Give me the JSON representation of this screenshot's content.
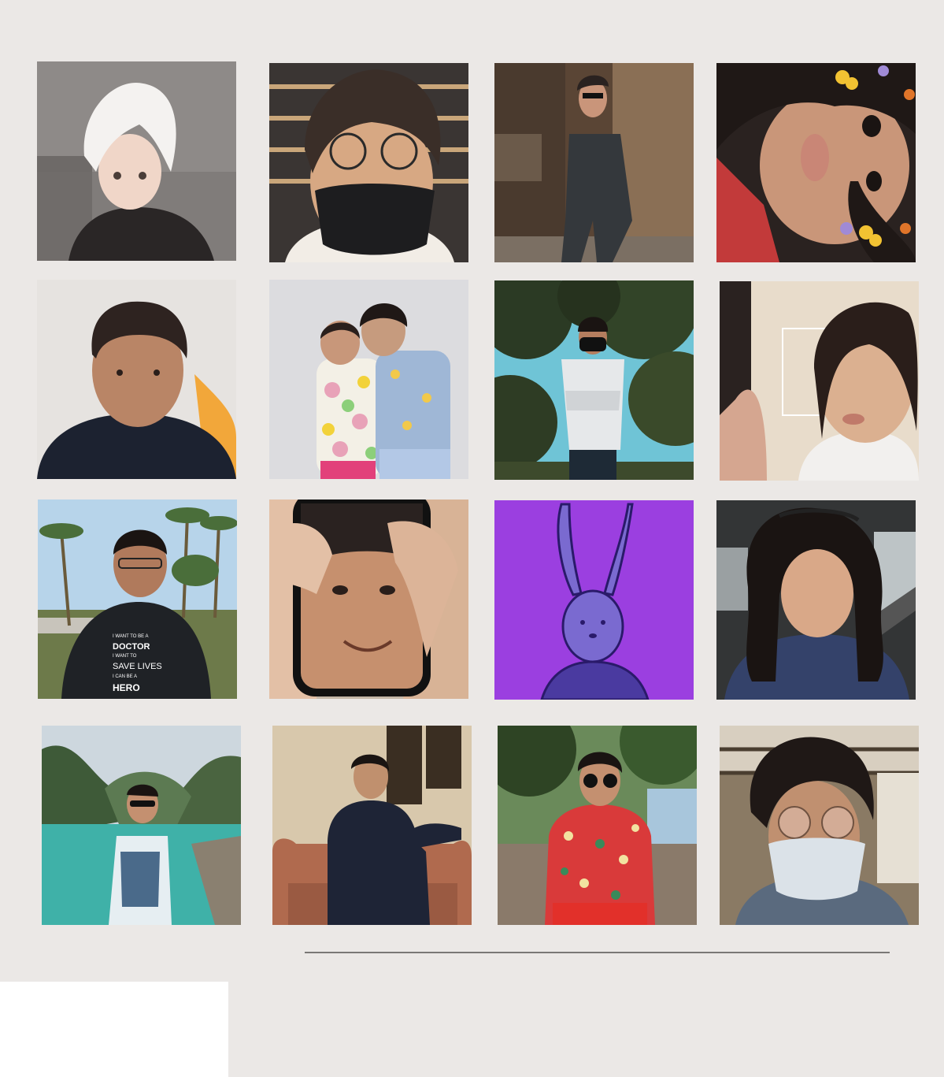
{
  "photos": [
    {
      "subject": "anime-style illustrated portrait, white hair",
      "shirt_text": ""
    },
    {
      "subject": "selfie with glasses and black face mask",
      "shirt_text": ""
    },
    {
      "subject": "mirror selfie in suit sitting on chair",
      "shirt_text": ""
    },
    {
      "subject": "selfie with butterfly stickers",
      "shirt_text": ""
    },
    {
      "subject": "portrait in dark t-shirt",
      "shirt_text": ""
    },
    {
      "subject": "two children posing in patterned tops",
      "shirt_text": ""
    },
    {
      "subject": "person in mask under tree, arms crossed",
      "shirt_text": ""
    },
    {
      "subject": "close-up selfie",
      "shirt_text": ""
    },
    {
      "subject": "portrait with palm trees",
      "shirt_text": "I WANT TO BE A DOCTOR I WANT TO SAVE LIVES I CAN BE A HERO"
    },
    {
      "subject": "phone showing a face held in hand",
      "shirt_text": ""
    },
    {
      "subject": "purple background rabbit drawing",
      "shirt_text": ""
    },
    {
      "subject": "car selfie",
      "shirt_text": ""
    },
    {
      "subject": "person by lagoon with cliffs",
      "shirt_text": ""
    },
    {
      "subject": "person sitting on leather couch",
      "shirt_text": ""
    },
    {
      "subject": "person in floral shirt with sunglasses",
      "shirt_text": ""
    },
    {
      "subject": "selfie with round glasses and face mask",
      "shirt_text": ""
    }
  ],
  "colors": {
    "page_background": "#ebe8e6",
    "divider": "#7a7876",
    "rabbit_background": "#9b3fe0"
  }
}
